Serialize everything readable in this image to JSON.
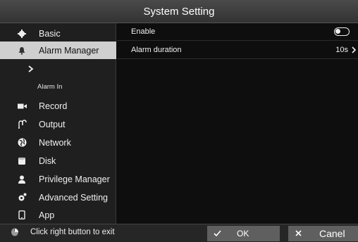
{
  "title": "System Setting",
  "sidebar": {
    "items": [
      {
        "label": "Basic",
        "icon": "gear-icon"
      },
      {
        "label": "Alarm Manager",
        "icon": "bell-icon",
        "active": true
      },
      {
        "label": "Record",
        "icon": "camera-icon"
      },
      {
        "label": "Output",
        "icon": "output-icon"
      },
      {
        "label": "Network",
        "icon": "globe-icon"
      },
      {
        "label": "Disk",
        "icon": "disk-icon"
      },
      {
        "label": "Privilege Manager",
        "icon": "user-icon"
      },
      {
        "label": "Advanced Setting",
        "icon": "advanced-gear-icon"
      },
      {
        "label": "App",
        "icon": "phone-icon"
      }
    ],
    "submenu": {
      "label": "Alarm In"
    }
  },
  "content": {
    "enable_label": "Enable",
    "enable_on": false,
    "duration_label": "Alarm duration",
    "duration_value": "10s"
  },
  "footer": {
    "hint": "Click right button to exit",
    "ok_label": "OK",
    "cancel_label": "Canel"
  },
  "colors": {
    "active_bg": "#cfcfcf",
    "button_bg": "#5f5f5f",
    "title_bg": "#3d3d3d"
  }
}
